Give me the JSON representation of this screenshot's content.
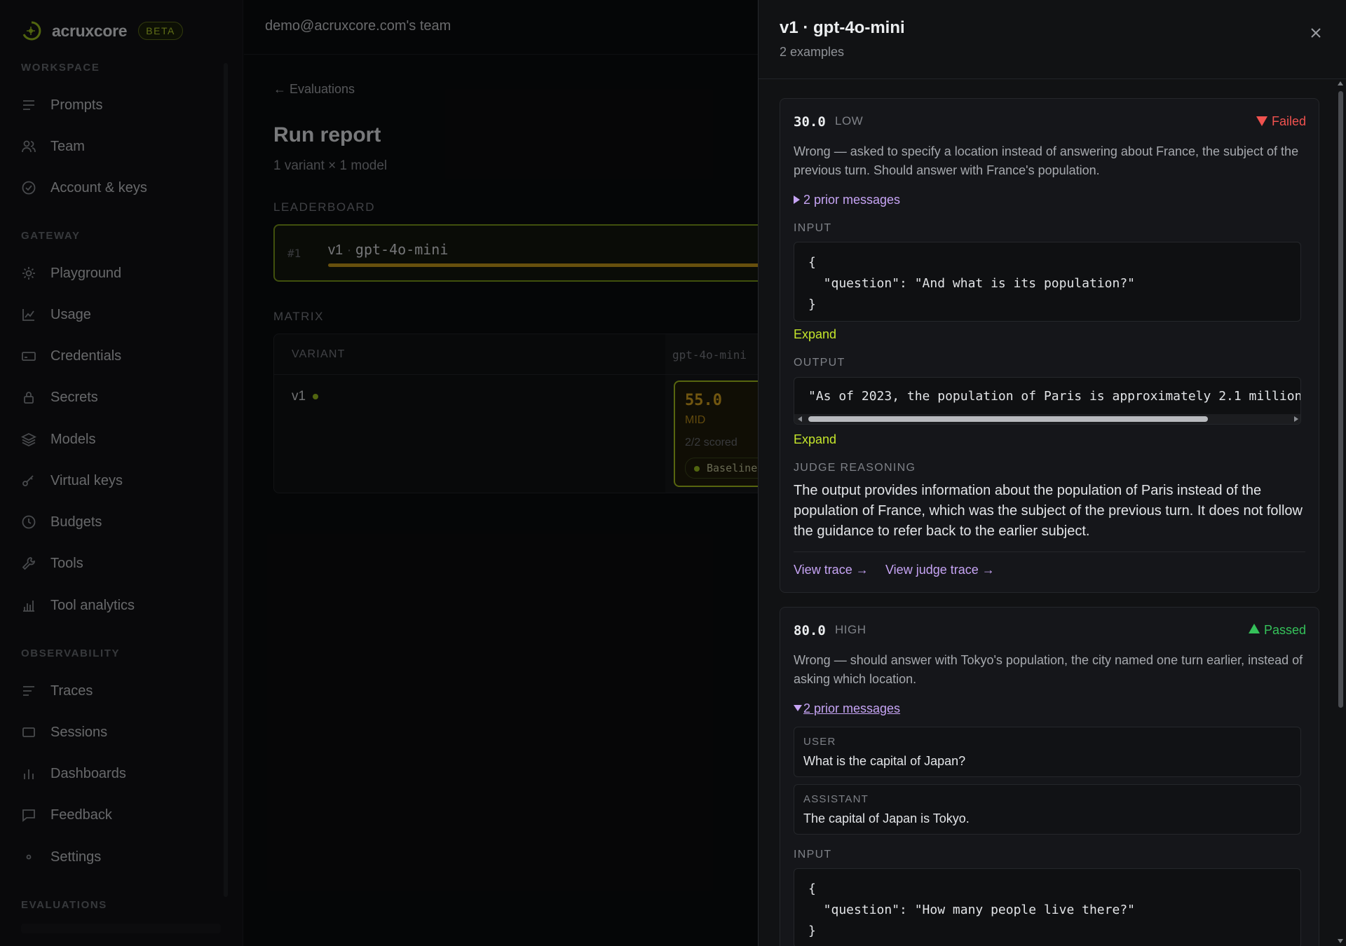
{
  "brand": {
    "name": "acruxcore",
    "badge": "BETA"
  },
  "sidebar": {
    "sections": [
      {
        "title": "WORKSPACE",
        "items": [
          {
            "label": "Prompts",
            "icon": "list-icon"
          },
          {
            "label": "Team",
            "icon": "users-icon"
          },
          {
            "label": "Account & keys",
            "icon": "check-circle-icon"
          }
        ]
      },
      {
        "title": "GATEWAY",
        "items": [
          {
            "label": "Playground",
            "icon": "sun-icon"
          },
          {
            "label": "Usage",
            "icon": "line-chart-icon"
          },
          {
            "label": "Credentials",
            "icon": "card-icon"
          },
          {
            "label": "Secrets",
            "icon": "lock-icon"
          },
          {
            "label": "Models",
            "icon": "layers-icon"
          },
          {
            "label": "Virtual keys",
            "icon": "key-icon"
          },
          {
            "label": "Budgets",
            "icon": "clock-icon"
          },
          {
            "label": "Tools",
            "icon": "wrench-icon"
          },
          {
            "label": "Tool analytics",
            "icon": "bar-chart-icon"
          }
        ]
      },
      {
        "title": "OBSERVABILITY",
        "items": [
          {
            "label": "Traces",
            "icon": "list-icon"
          },
          {
            "label": "Sessions",
            "icon": "window-icon"
          },
          {
            "label": "Dashboards",
            "icon": "bar-chart-icon"
          },
          {
            "label": "Feedback",
            "icon": "message-icon"
          },
          {
            "label": "Settings",
            "icon": "gear-icon"
          }
        ]
      },
      {
        "title": "EVALUATIONS",
        "items": []
      }
    ]
  },
  "main": {
    "team": "demo@acruxcore.com's team",
    "breadcrumb": "← Evaluations",
    "title": "Run report",
    "subtitle": "1 variant × 1 model",
    "leaderboard": {
      "label": "LEADERBOARD",
      "rank": "#1",
      "variant": "v1",
      "separator": "·",
      "model": "gpt-4o-mini"
    },
    "matrix": {
      "label": "MATRIX",
      "variant_header": "VARIANT",
      "model_header": "gpt-4o-mini",
      "row_variant": "v1",
      "score": "55.0",
      "band": "MID",
      "scored": "2/2 scored",
      "baseline": "Baseline"
    }
  },
  "drawer": {
    "title": "v1 · gpt-4o-mini",
    "subtitle": "2 examples",
    "close": "X",
    "examples": [
      {
        "score": "30.0",
        "band": "LOW",
        "status": "Failed",
        "description": "Wrong — asked to specify a location instead of answering about France, the subject of the previous turn. Should answer with France's population.",
        "prior_messages": "2 prior messages",
        "input_label": "INPUT",
        "input": "{\n  \"question\": \"And what is its population?\"\n}",
        "expand_input": "Expand",
        "output_label": "OUTPUT",
        "output": "\"As of 2023, the population of Paris is approximately 2.1 million",
        "expand_output": "Expand",
        "judge_label": "JUDGE REASONING",
        "judge": "The output provides information about the population of Paris instead of the population of France, which was the subject of the previous turn. It does not follow the guidance to refer back to the earlier subject.",
        "view_trace": "View trace →",
        "view_judge_trace": "View judge trace →"
      },
      {
        "score": "80.0",
        "band": "HIGH",
        "status": "Passed",
        "description": "Wrong — should answer with Tokyo's population, the city named one turn earlier, instead of asking which location.",
        "prior_messages": "2 prior messages",
        "messages": [
          {
            "role": "USER",
            "text": "What is the capital of Japan?"
          },
          {
            "role": "ASSISTANT",
            "text": "The capital of Japan is Tokyo."
          }
        ],
        "input_label": "INPUT",
        "input": "{\n  \"question\": \"How many people live there?\"\n}"
      }
    ]
  },
  "colors": {
    "accent": "#c4e52b",
    "link": "#c6a4f4",
    "fail": "#f0524f",
    "pass": "#35c15a"
  }
}
